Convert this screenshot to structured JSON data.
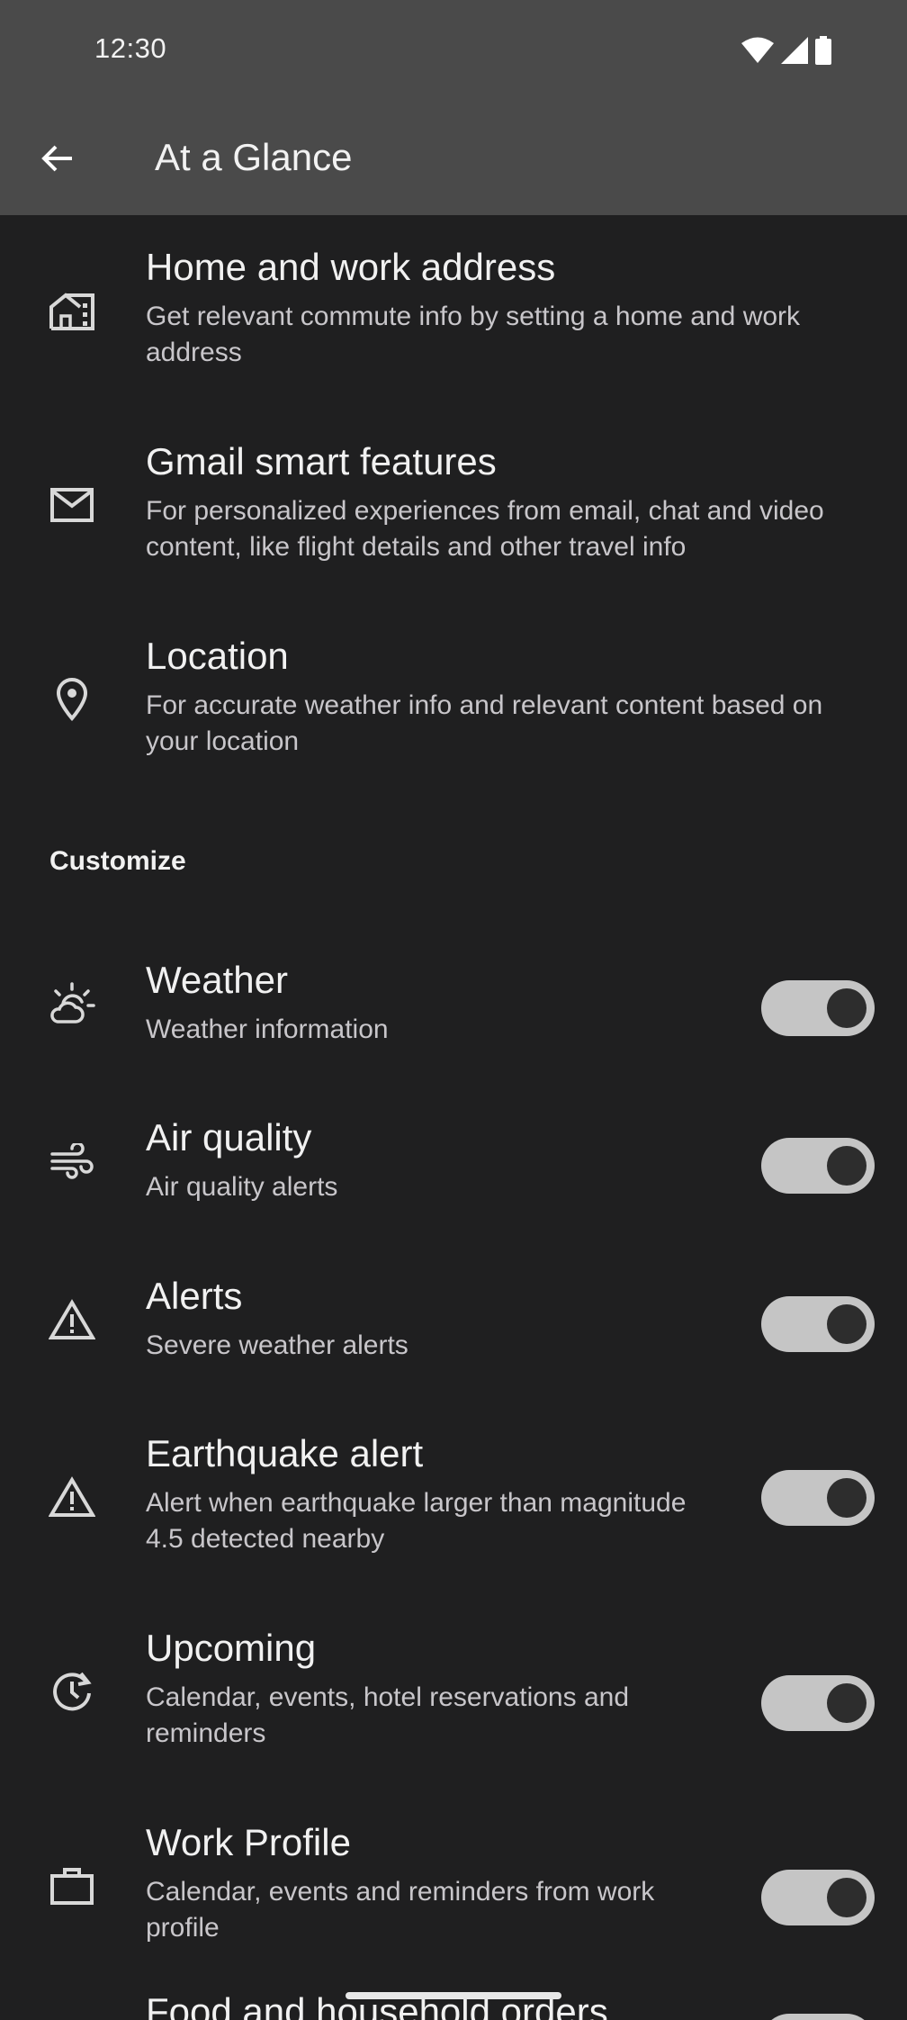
{
  "status_bar": {
    "time": "12:30",
    "icons": [
      "wifi-icon",
      "signal-icon",
      "battery-icon"
    ]
  },
  "app_bar": {
    "back_icon": "arrow-back-icon",
    "title": "At a Glance"
  },
  "account_items": [
    {
      "icon": "home-work-icon",
      "title": "Home and work address",
      "subtitle": "Get relevant commute info by setting a home and work address"
    },
    {
      "icon": "mail-icon",
      "title": "Gmail smart features",
      "subtitle": "For personalized experiences from email, chat and video content, like flight details and other travel info"
    },
    {
      "icon": "location-pin-icon",
      "title": "Location",
      "subtitle": "For accurate weather info and relevant content based on your location"
    }
  ],
  "customize": {
    "header": "Customize",
    "items": [
      {
        "icon": "partly-cloudy-icon",
        "title": "Weather",
        "subtitle": "Weather information",
        "enabled": true
      },
      {
        "icon": "air-icon",
        "title": "Air quality",
        "subtitle": "Air quality alerts",
        "enabled": true
      },
      {
        "icon": "warning-icon",
        "title": "Alerts",
        "subtitle": "Severe weather alerts",
        "enabled": true
      },
      {
        "icon": "warning-icon",
        "title": "Earthquake alert",
        "subtitle": "Alert when earthquake larger than magnitude 4.5 detected nearby",
        "enabled": true
      },
      {
        "icon": "upcoming-icon",
        "title": "Upcoming",
        "subtitle": "Calendar, events, hotel reservations and reminders",
        "enabled": true
      },
      {
        "icon": "briefcase-icon",
        "title": "Work Profile",
        "subtitle": "Calendar, events and reminders from work profile",
        "enabled": true
      },
      {
        "icon": "shopping-icon",
        "title": "Food and household orders",
        "subtitle": "",
        "enabled": true
      }
    ]
  },
  "colors": {
    "app_bar_bg": "#4a4a4a",
    "page_bg": "#1f1f20",
    "toggle_track": "#c5c5c5",
    "toggle_thumb": "#2d2d2d"
  }
}
